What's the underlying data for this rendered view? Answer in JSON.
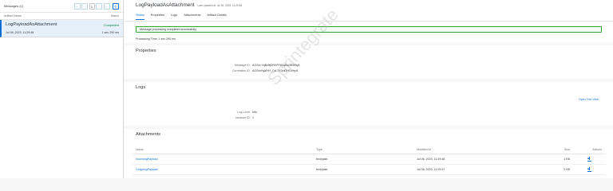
{
  "left_panel": {
    "title": "Messages (1)",
    "pager": {
      "first": "«",
      "prev": "‹",
      "page": "1",
      "next": "›",
      "last": "»",
      "refresh": "↻"
    },
    "columns": {
      "name": "Artifact Name",
      "status": "Status"
    },
    "items": [
      {
        "name": "LogPayloadAsAttachment",
        "status": "Completed",
        "date": "Jul 06, 2023, 11:29:48",
        "duration": "1 sec 290 ms"
      }
    ]
  },
  "header": {
    "title": "LogPayloadAsAttachment",
    "subtitle": "Last Updated at: Jul 06, 2023, 11:29:48",
    "tabs": [
      "Status",
      "Properties",
      "Logs",
      "Attachments",
      "Artifact Details"
    ]
  },
  "status": {
    "banner": "Message processing completed successfully.",
    "processing_time": "Processing Time: 1 sec 290 ms"
  },
  "properties": {
    "title": "Properties",
    "message_id_label": "Message ID:",
    "message_id": "AGSm YqBzffjGRHFF80q8Iu3RM9g5",
    "correlation_id_label": "Correlation ID:",
    "correlation_id": "AGSmYqAFrH_CsLTX3oiOHCfHrp5"
  },
  "logs": {
    "title": "Logs",
    "open_text_view": "Open Text View",
    "log_level_label": "Log Level:",
    "log_level": "Info",
    "instance_id_label": "Instance ID:",
    "instance_id": "1"
  },
  "attachments": {
    "title": "Attachments",
    "columns": {
      "name": "Name",
      "type": "Type",
      "modified": "Modified At",
      "size": "Size",
      "actions": "Actions"
    },
    "rows": [
      {
        "name": "IncomingPayload",
        "type": "text/plain",
        "modified": "Jul 06, 2023, 11:29:48",
        "size": "1 KB"
      },
      {
        "name": "OutgoingPayload",
        "type": "text/plain",
        "modified": "Jul 06, 2023, 11:29:47",
        "size": "2 KB"
      }
    ]
  },
  "watermark": "Sprintegrate",
  "colors": {
    "accent": "#0a6ed1",
    "success": "#107e3e",
    "banner_border": "#38a238"
  }
}
